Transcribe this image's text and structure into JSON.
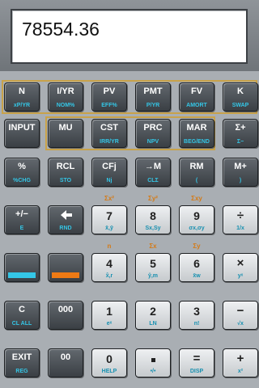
{
  "display": {
    "value": "78554.36"
  },
  "colors": {
    "accent_cyan": "#34c6e6",
    "accent_orange": "#ee7a14",
    "gold_frame": "#c8a24a"
  },
  "rows": [
    [
      {
        "name": "n-key",
        "main": "N",
        "sub": "xP/YR",
        "style": "dark"
      },
      {
        "name": "i-yr-key",
        "main": "I/YR",
        "sub": "NOM%",
        "style": "dark"
      },
      {
        "name": "pv-key",
        "main": "PV",
        "sub": "EFF%",
        "style": "dark"
      },
      {
        "name": "pmt-key",
        "main": "PMT",
        "sub": "P/YR",
        "style": "dark"
      },
      {
        "name": "fv-key",
        "main": "FV",
        "sub": "AMORT",
        "style": "dark"
      },
      {
        "name": "k-key",
        "main": "K",
        "sub": "SWAP",
        "style": "dark"
      }
    ],
    [
      {
        "name": "input-key",
        "main": "INPUT",
        "sub": "",
        "style": "dark"
      },
      {
        "name": "mu-key",
        "main": "MU",
        "sub": "",
        "style": "dark"
      },
      {
        "name": "cst-key",
        "main": "CST",
        "sub": "IRR/YR",
        "style": "dark"
      },
      {
        "name": "prc-key",
        "main": "PRC",
        "sub": "NPV",
        "style": "dark"
      },
      {
        "name": "mar-key",
        "main": "MAR",
        "sub": "BEG/END",
        "style": "dark"
      },
      {
        "name": "sigma-plus-key",
        "main": "Σ+",
        "sub": "Σ−",
        "style": "dark"
      }
    ],
    [
      {
        "name": "percent-key",
        "main": "%",
        "sub": "%CHG",
        "style": "dark"
      },
      {
        "name": "rcl-key",
        "main": "RCL",
        "sub": "STO",
        "style": "dark"
      },
      {
        "name": "cfj-key",
        "main": "CFj",
        "sub": "Nj",
        "style": "dark"
      },
      {
        "name": "to-m-key",
        "main": "→M",
        "sub": "CLΣ",
        "style": "dark"
      },
      {
        "name": "rm-key",
        "main": "RM",
        "sub": "(",
        "style": "dark"
      },
      {
        "name": "m-plus-key",
        "main": "M+",
        "sub": ")",
        "style": "dark"
      }
    ],
    [
      {
        "name": "change-sign-key",
        "main": "+/−",
        "sub": "E",
        "style": "dark"
      },
      {
        "name": "backspace-key",
        "main": "",
        "sub": "RND",
        "style": "dark",
        "icon": "left-arrow"
      },
      {
        "name": "digit-7-key",
        "main": "7",
        "sub": "x̄,ȳ",
        "style": "light",
        "gold": "Σx²"
      },
      {
        "name": "digit-8-key",
        "main": "8",
        "sub": "Sx,Sy",
        "style": "light",
        "gold": "Σy²"
      },
      {
        "name": "digit-9-key",
        "main": "9",
        "sub": "σx,σy",
        "style": "light",
        "gold": "Σxy"
      },
      {
        "name": "divide-key",
        "main": "÷",
        "sub": "1/x",
        "style": "light"
      }
    ],
    [
      {
        "name": "cyan-shift-key",
        "main": "",
        "sub": "",
        "style": "dark",
        "swatch": "#34c6e6"
      },
      {
        "name": "orange-shift-key",
        "main": "",
        "sub": "",
        "style": "dark",
        "swatch": "#ee7a14"
      },
      {
        "name": "digit-4-key",
        "main": "4",
        "sub": "x̂,r",
        "style": "light",
        "gold": "n"
      },
      {
        "name": "digit-5-key",
        "main": "5",
        "sub": "ŷ,m",
        "style": "light",
        "gold": "Σx"
      },
      {
        "name": "digit-6-key",
        "main": "6",
        "sub": "x̄w",
        "style": "light",
        "gold": "Σy"
      },
      {
        "name": "multiply-key",
        "main": "×",
        "sub": "yˣ",
        "style": "light"
      }
    ],
    [
      {
        "name": "clear-key",
        "main": "C",
        "sub": "CL ALL",
        "style": "dark"
      },
      {
        "name": "triple-zero-key",
        "main": "000",
        "sub": "",
        "style": "dark"
      },
      {
        "name": "digit-1-key",
        "main": "1",
        "sub": "eˣ",
        "style": "light"
      },
      {
        "name": "digit-2-key",
        "main": "2",
        "sub": "LN",
        "style": "light"
      },
      {
        "name": "digit-3-key",
        "main": "3",
        "sub": "n!",
        "style": "light"
      },
      {
        "name": "subtract-key",
        "main": "−",
        "sub": "√x",
        "style": "light"
      }
    ],
    [
      {
        "name": "exit-key",
        "main": "EXIT",
        "sub": "REG",
        "style": "dark"
      },
      {
        "name": "double-zero-key",
        "main": "00",
        "sub": "",
        "style": "dark"
      },
      {
        "name": "digit-0-key",
        "main": "0",
        "sub": "HELP",
        "style": "light"
      },
      {
        "name": "decimal-key",
        "main": "",
        "sub": "•/•",
        "style": "light",
        "icon": "dot"
      },
      {
        "name": "equals-key",
        "main": "=",
        "sub": "DISP",
        "style": "light"
      },
      {
        "name": "add-key",
        "main": "+",
        "sub": "x²",
        "style": "light"
      }
    ]
  ]
}
